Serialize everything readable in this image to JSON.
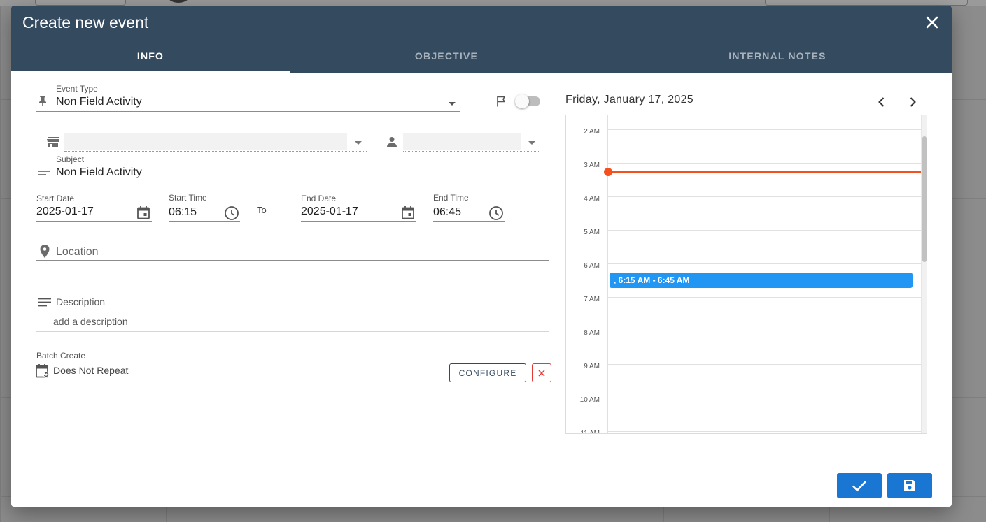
{
  "dialog": {
    "title": "Create new event",
    "tabs": [
      {
        "label": "INFO",
        "active": true
      },
      {
        "label": "OBJECTIVE",
        "active": false
      },
      {
        "label": "INTERNAL NOTES",
        "active": false
      }
    ]
  },
  "form": {
    "event_type": {
      "label": "Event Type",
      "value": "Non Field Activity"
    },
    "flag_toggle": {
      "on": false
    },
    "store_select": {
      "value": ""
    },
    "person_select": {
      "value": ""
    },
    "subject": {
      "label": "Subject",
      "value": "Non Field Activity"
    },
    "start_date": {
      "label": "Start Date",
      "value": "2025-01-17"
    },
    "start_time": {
      "label": "Start Time",
      "value": "06:15"
    },
    "to_label": "To",
    "end_date": {
      "label": "End Date",
      "value": "2025-01-17"
    },
    "end_time": {
      "label": "End Time",
      "value": "06:45"
    },
    "location": {
      "placeholder": "Location"
    },
    "description": {
      "label": "Description",
      "placeholder": "add a description"
    },
    "batch_create": {
      "label": "Batch Create",
      "value": "Does Not Repeat",
      "configure_label": "CONFIGURE"
    }
  },
  "calendar": {
    "date_title": "Friday, January 17, 2025",
    "hours": [
      "2 AM",
      "3 AM",
      "4 AM",
      "5 AM",
      "6 AM",
      "7 AM",
      "8 AM",
      "9 AM",
      "10 AM",
      "11 AM"
    ],
    "event_label": ", 6:15 AM - 6:45 AM",
    "colors": {
      "now_line": "#f4511e",
      "event": "#2196f3"
    }
  },
  "actions": {
    "confirm_icon": "check-icon",
    "save_icon": "save-icon"
  },
  "colors": {
    "header": "#344a5f",
    "primary": "#1976d2",
    "danger": "#e53935"
  }
}
